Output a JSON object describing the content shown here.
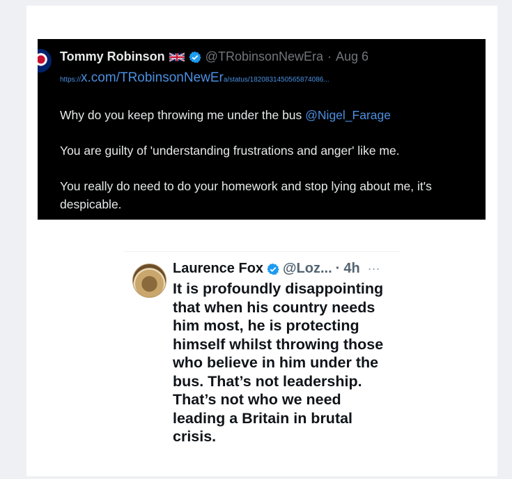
{
  "tweet1": {
    "name": "Tommy Robinson",
    "handle": "@TRobinsonNewEra",
    "separator": "·",
    "date": "Aug 6",
    "link_prefix": "https://",
    "link_main": "x.com/TRobinsonNewEr",
    "link_suffix": "a/status/1820831450565874086...",
    "line1_text": "Why do you keep throwing me under the bus ",
    "line1_mention": "@Nigel_Farage",
    "line2": "You are guilty of 'understanding frustrations and anger' like me.",
    "line3": "You really do need to do your homework and stop lying about me, it's despicable."
  },
  "tweet2": {
    "name": "Laurence Fox",
    "handle": "@Loz...",
    "separator": "·",
    "time": "4h",
    "more": "···",
    "text": "It is profoundly disappointing that when his country needs him most, he is protecting himself whilst throwing those who believe in him under the bus. That’s not leadership. That’s not who we need leading a Britain in brutal crisis."
  },
  "colors": {
    "verified": "#1d9bf0",
    "link": "#4a90e2",
    "dark_bg": "#000000"
  },
  "icons": [
    "uk-flag-icon",
    "verified-badge-icon",
    "more-icon"
  ]
}
